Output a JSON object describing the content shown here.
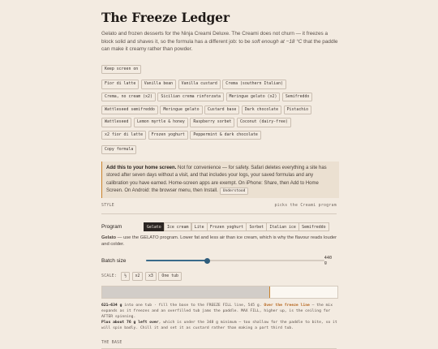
{
  "title": "The Freeze Ledger",
  "intro": {
    "before": "Gelato and frozen desserts for the Ninja Creami Deluxe. The Creami does not churn — it freezes a block solid and shaves it, so the formula has a different job: to be ",
    "emphasis": "soft enough at −18 °C",
    "after": " that the paddle can make it creamy rather than powder."
  },
  "keep_screen_on": "Keep screen on",
  "recipes": [
    [
      "Fior di latte",
      "Vanilla bean",
      "Vanilla custard",
      "Crema (southern Italian)"
    ],
    [
      "Crema, no cream (x2)",
      "Sicilian crema rinforzata",
      "Meringue gelato (x2)",
      "Semifreddo"
    ],
    [
      "Wattleseed semifreddo",
      "Meringue gelato",
      "Custard base",
      "Dark chocolate",
      "Pistachio"
    ],
    [
      "Wattleseed",
      "Lemon myrtle & honey",
      "Raspberry sorbet",
      "Coconut (dairy-free)"
    ],
    [
      "x2 fior di latte",
      "Frozen yoghurt",
      "Peppermint & dark chocolate"
    ]
  ],
  "copy_formula": "Copy formula",
  "notice": {
    "bold": "Add this to your home screen.",
    "text": " Not for convenience — for safety. Safari deletes everything a site has stored after seven days without a visit, and that includes your logs, your saved formulas and any calibration you have earned. Home-screen apps are exempt. On iPhone: Share, then Add to Home Screen. On Android: the browser menu, then Install.",
    "button": "Understood"
  },
  "style_label": "STYLE",
  "style_hint": "picks the Creami program",
  "program": {
    "label": "Program",
    "tabs": [
      "Gelato",
      "Ice cream",
      "Lite",
      "Frozen yoghurt",
      "Sorbet",
      "Italian ice",
      "Semifreddo"
    ],
    "active": 0,
    "note_bold": "Gelato",
    "note": " — use the GELATO program. Lower fat and less air than ice cream, which is why the flavour reads louder and colder."
  },
  "batch": {
    "label": "Batch size",
    "value": 440,
    "value_text": "440 g",
    "min": 200,
    "max": 900
  },
  "scale": {
    "label": "SCALE:",
    "options": [
      "½",
      "x2",
      "x3",
      "One tub"
    ]
  },
  "fill": {
    "used_fraction": 0.71,
    "fill_line_fraction": 0.71
  },
  "detail": {
    "line1_bold": "621–634 g",
    "line1": " into one tub · fill the base to the FREEZE FILL line, 545 g. ",
    "line1_warn": "Over the freeze line",
    "line1_end": " — the mix expands as it freezes and an overfilled tub jams the paddle. MAX FILL, higher up, is the ceiling for AFTER spinning.",
    "line2_bold": "Plus about 76 g left over",
    "line2": ", which is under the 348 g minimum — too shallow for the paddle to bite, so it will spin badly. Chill it and set it as custard rather than making a part third tub."
  },
  "base_header": "THE BASE",
  "colors": {
    "accent": "#c9822b",
    "slider": "#2f5d7c",
    "active_tab": "#2b2522"
  }
}
